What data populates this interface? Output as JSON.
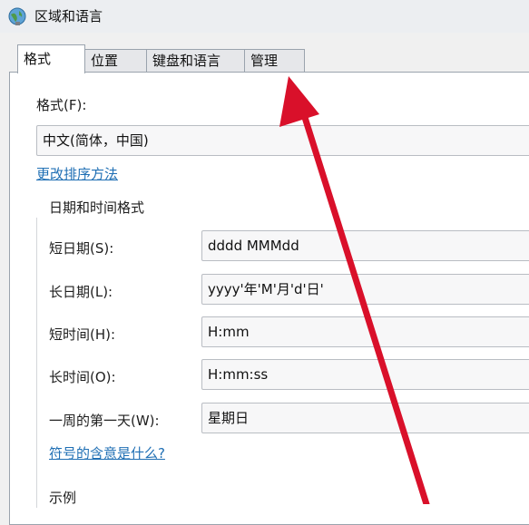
{
  "window": {
    "title": "区域和语言"
  },
  "tabs": [
    {
      "label": "格式"
    },
    {
      "label": "位置"
    },
    {
      "label": "键盘和语言"
    },
    {
      "label": "管理"
    }
  ],
  "format": {
    "label": "格式(F):",
    "value": "中文(简体，中国)",
    "change_sort_link": "更改排序方法"
  },
  "datetime": {
    "group_title": "日期和时间格式",
    "rows": [
      {
        "label": "短日期(S):",
        "value": "dddd  MMMdd"
      },
      {
        "label": "长日期(L):",
        "value": "yyyy'年'M'月'd'日'"
      },
      {
        "label": "短时间(H):",
        "value": "H:mm"
      },
      {
        "label": "长时间(O):",
        "value": "H:mm:ss"
      },
      {
        "label": "一周的第一天(W):",
        "value": "星期日"
      }
    ],
    "symbols_link": "符号的含意是什么?"
  },
  "example": {
    "label": "示例"
  },
  "colors": {
    "accent_arrow": "#d9102a",
    "link": "#1f6fb4"
  },
  "icons": {
    "title": "globe-icon",
    "annotation": "red-arrow"
  }
}
